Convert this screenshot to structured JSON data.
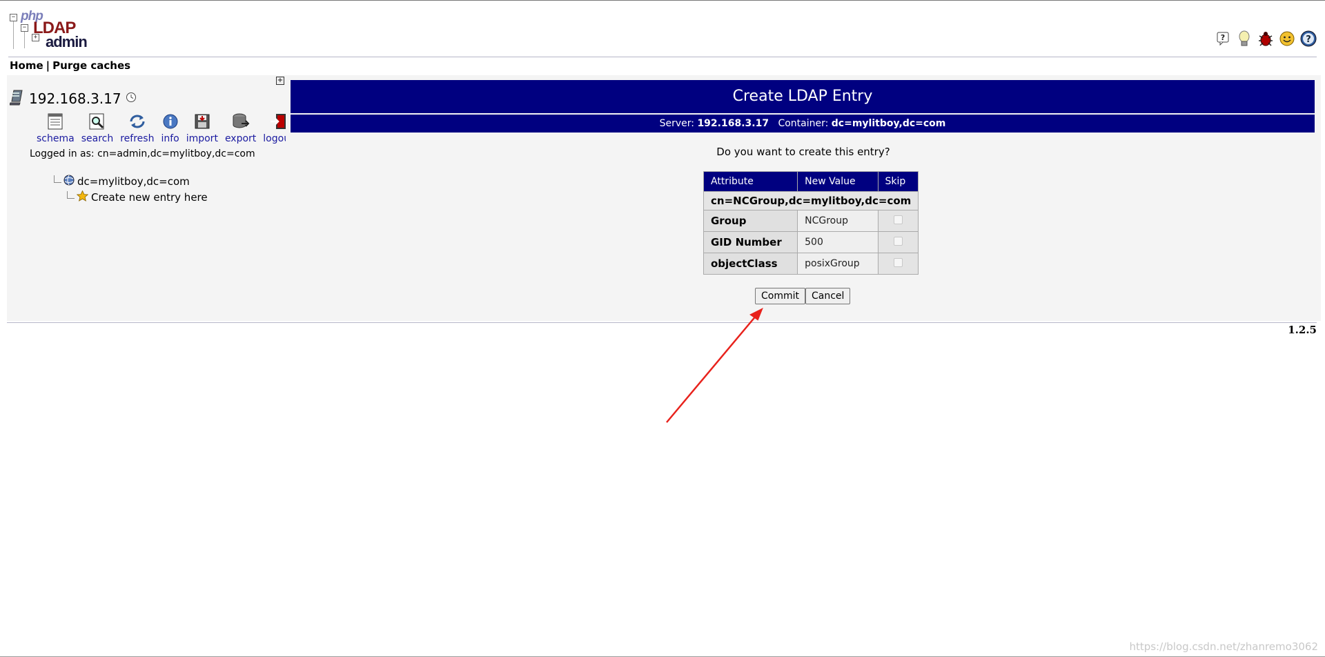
{
  "header": {
    "logo": {
      "php": "php",
      "ldap": "LDAP",
      "admin": "admin"
    },
    "icons": [
      "request-feature-icon",
      "tips-icon",
      "report-bug-icon",
      "donate-icon",
      "help-icon"
    ]
  },
  "menu": {
    "home": "Home",
    "separator": "|",
    "purge": "Purge caches"
  },
  "sidebar": {
    "server": "192.168.3.17",
    "tools": [
      {
        "label": "schema",
        "icon": "schema-icon"
      },
      {
        "label": "search",
        "icon": "search-icon"
      },
      {
        "label": "refresh",
        "icon": "refresh-icon"
      },
      {
        "label": "info",
        "icon": "info-icon"
      },
      {
        "label": "import",
        "icon": "import-icon"
      },
      {
        "label": "export",
        "icon": "export-icon"
      },
      {
        "label": "logout",
        "icon": "logout-icon"
      }
    ],
    "logged_in_label": "Logged in as: cn=admin,dc=mylitboy,dc=com",
    "tree": {
      "root": "dc=mylitboy,dc=com",
      "child": "Create new entry here"
    }
  },
  "main": {
    "title": "Create LDAP Entry",
    "server_label": "Server:",
    "server_value": "192.168.3.17",
    "container_label": "Container:",
    "container_value": "dc=mylitboy,dc=com",
    "question": "Do you want to create this entry?",
    "table": {
      "headers": [
        "Attribute",
        "New Value",
        "Skip"
      ],
      "dn": "cn=NCGroup,dc=mylitboy,dc=com",
      "rows": [
        {
          "attribute": "Group",
          "value": "NCGroup"
        },
        {
          "attribute": "GID Number",
          "value": "500"
        },
        {
          "attribute": "objectClass",
          "value": "posixGroup"
        }
      ]
    },
    "commit_label": "Commit",
    "cancel_label": "Cancel"
  },
  "footer": {
    "version": "1.2.5"
  },
  "watermark": "https://blog.csdn.net/zhanremo3062",
  "colors": {
    "accent": "#000080",
    "panel": "#f4f4f4",
    "annotation": "#e8221c"
  }
}
